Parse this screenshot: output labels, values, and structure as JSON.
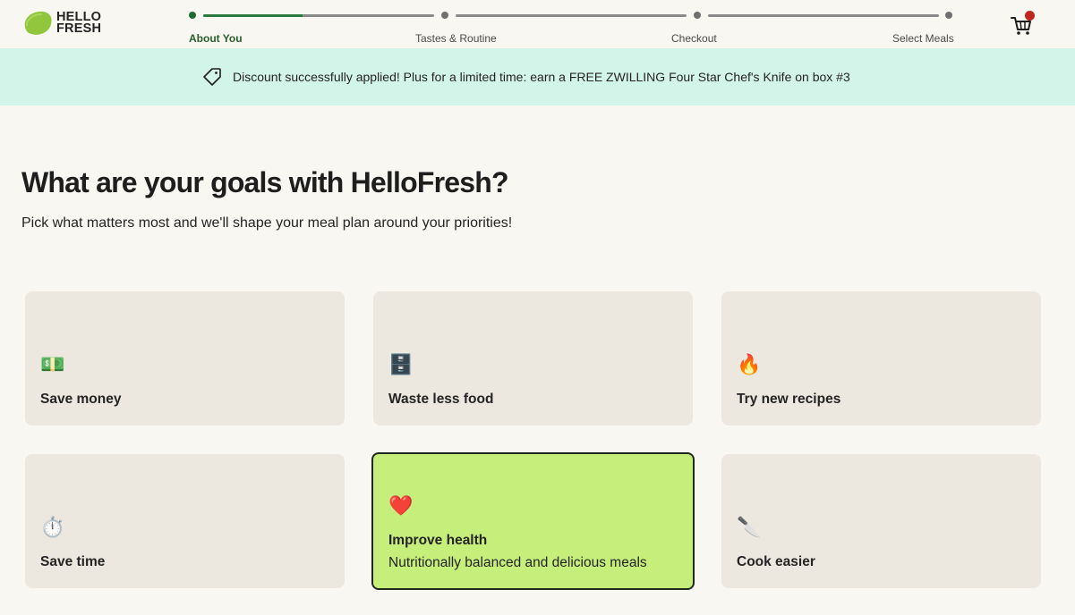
{
  "logo": {
    "line1": "HELLO",
    "line2": "FRESH",
    "brand_color": "#8bc34a"
  },
  "progress": {
    "steps": [
      {
        "label": "About You",
        "active": true
      },
      {
        "label": "Tastes & Routine",
        "active": false
      },
      {
        "label": "Checkout",
        "active": false
      },
      {
        "label": "Select Meals",
        "active": false
      }
    ],
    "first_segment_fill": 0.43,
    "active_color": "#2d7a3e"
  },
  "cart": {
    "icon": "cart-icon",
    "badge_color": "#c0261f"
  },
  "banner": {
    "icon": "tag-icon",
    "text": "Discount successfully applied! Plus for a limited time: earn a FREE ZWILLING Four Star Chef's Knife on box #3",
    "background": "#d3f4e9"
  },
  "main": {
    "title": "What are your goals with HelloFresh?",
    "subtitle": "Pick what matters most and we'll shape your meal plan around your priorities!"
  },
  "goals": [
    {
      "emoji": "💵",
      "icon": "money-icon",
      "label": "Save money",
      "selected": false
    },
    {
      "emoji": "🗄️",
      "icon": "fridge-icon",
      "label": "Waste less food",
      "selected": false
    },
    {
      "emoji": "🔥",
      "icon": "fire-icon",
      "label": "Try new recipes",
      "selected": false
    },
    {
      "emoji": "⏱️",
      "icon": "stopwatch-icon",
      "label": "Save time",
      "selected": false
    },
    {
      "emoji": "❤️",
      "icon": "heart-icon",
      "label": "Improve health",
      "description": "Nutritionally balanced and delicious meals",
      "selected": true
    },
    {
      "emoji": "🔪",
      "icon": "cutting-board-icon",
      "label": "Cook easier",
      "selected": false
    }
  ],
  "colors": {
    "card_bg": "#ede8df",
    "selected_bg": "#c6ee7b",
    "page_bg": "#f9f7f2"
  }
}
